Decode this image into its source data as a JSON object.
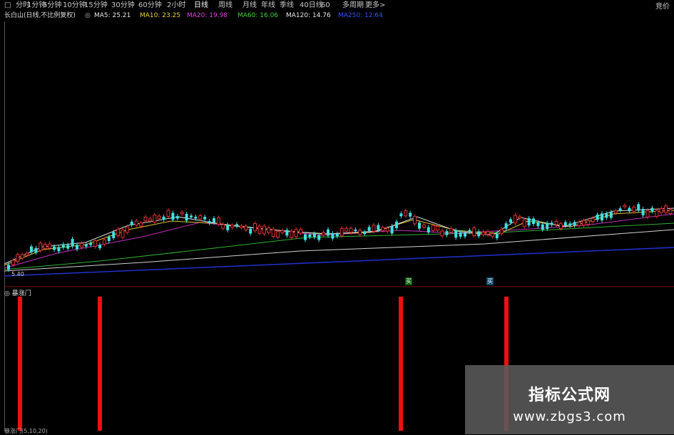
{
  "toolbar": {
    "tabs": [
      "分时",
      "1分钟",
      "5分钟",
      "10分钟",
      "15分钟",
      "30分钟",
      "60分钟",
      "2小时",
      "日线",
      "周线",
      "月线",
      "年线",
      "季线",
      "40日线",
      "60",
      "多周期",
      "更多>"
    ],
    "active_index": 8,
    "right_label": "竞价"
  },
  "ma_bar": {
    "title": "长白山(日线,不比例复权)",
    "items": [
      {
        "text": "MA5: 25.21",
        "color": "#e8e8e8"
      },
      {
        "text": "MA10: 23.25",
        "color": "#e8d040"
      },
      {
        "text": "MA20: 19.98",
        "color": "#e040e0"
      },
      {
        "text": "MA60: 16.06",
        "color": "#40d040"
      },
      {
        "text": "MA120: 14.76",
        "color": "#e8e8e8"
      },
      {
        "text": "MA250: 12.64",
        "color": "#3050ff"
      }
    ]
  },
  "main_chart": {
    "low_label": "5.40",
    "signal_labels": [
      {
        "text": "买",
        "color": "#40d040"
      },
      {
        "text": "买",
        "color": "#40d0ff"
      }
    ]
  },
  "sub_chart": {
    "title": "暴涨门",
    "bottom_text": "暴涨门(5,10,20)"
  },
  "watermark": {
    "line1": "指标公式网",
    "line2": "www.zbgs3.com"
  }
}
